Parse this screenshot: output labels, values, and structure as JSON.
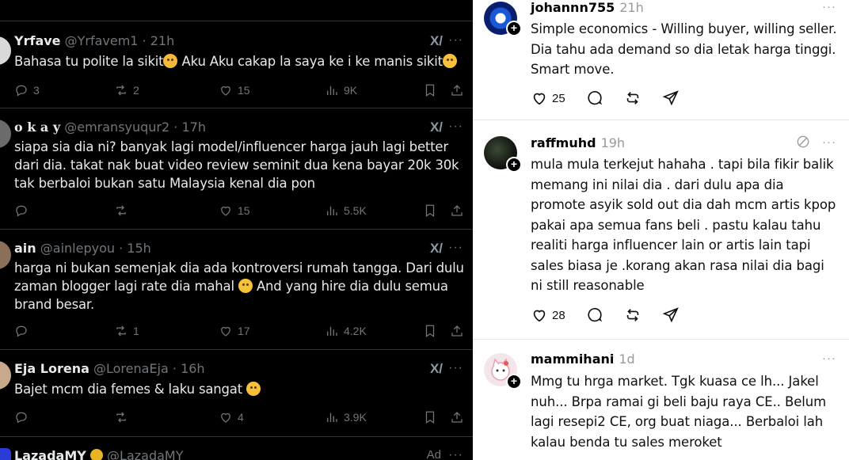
{
  "twitter": {
    "tweets": [
      {
        "name": "Yrfave",
        "handle": "@Yrfavem1",
        "time": "21h",
        "text_before": "Bahasa tu polite la sikit",
        "text_mid": " Aku Aku cakap la saya ke i ke manis sikit",
        "replies": "3",
        "reposts": "2",
        "likes": "15",
        "views": "9K"
      },
      {
        "name": "o k a y",
        "handle": "@emransyuqur2",
        "time": "17h",
        "text": "siapa sia dia ni? banyak lagi model/influencer harga jauh lagi better dari dia. takat nak buat video review seminit dua kena bayar 20k 30k tak berbaloi bukan satu Malaysia kenal dia pon",
        "replies": "",
        "reposts": "",
        "likes": "15",
        "views": "5.5K"
      },
      {
        "name": "ain",
        "handle": "@ainlepyou",
        "time": "15h",
        "text_before": "harga ni bukan semenjak dia ada kontroversi rumah tangga. Dari dulu zaman blogger lagi rate dia mahal ",
        "text_after": " And yang hire dia dulu semua brand besar.",
        "replies": "",
        "reposts": "1",
        "likes": "17",
        "views": "4.2K"
      },
      {
        "name": "Eja Lorena",
        "handle": "@LorenaEja",
        "time": "16h",
        "text_before": "Bajet mcm dia femes & laku sangat ",
        "replies": "",
        "reposts": "",
        "likes": "4",
        "views": "3.9K"
      },
      {
        "name": "LazadaMY",
        "handle": "@LazadaMY",
        "ad": "Ad"
      }
    ],
    "sep": " · ",
    "more": "···",
    "grok": "X/"
  },
  "threads": {
    "posts": [
      {
        "user": "johannn755",
        "time": "21h",
        "text": "Simple economics - Willing buyer, willing seller. Dia tahu ada demand so dia letak harga tinggi. Smart move.",
        "likes": "25"
      },
      {
        "user": "raffmuhd",
        "time": "19h",
        "text": "mula mula terkejut hahaha . tapi bila fikir balik memang ini nilai dia . dari dulu apa dia promote asyik sold out dia dah mcm artis kpop pakai apa semua fans beli . pastu kalau tahu realiti harga influencer lain or artis lain tapi sales biasa je .korang akan rasa nilai dia bagi ni still reasonable",
        "likes": "28"
      },
      {
        "user": "mammihani",
        "time": "1d",
        "text": "Mmg tu hrga market. Tgk kuasa ce lh... Jakel nuh... Brpa ramai gi beli baju raya CE.. Belum lagi resepi2 CE, org buat niaga... Berbaloi lah kalau benda tu sales meroket"
      }
    ],
    "more": "···",
    "plus": "+"
  },
  "colors": {
    "x_bg": "#000000",
    "x_text": "#e7e9ea",
    "x_muted": "#71767b",
    "threads_bg": "#ffffff",
    "threads_muted": "#999999"
  }
}
